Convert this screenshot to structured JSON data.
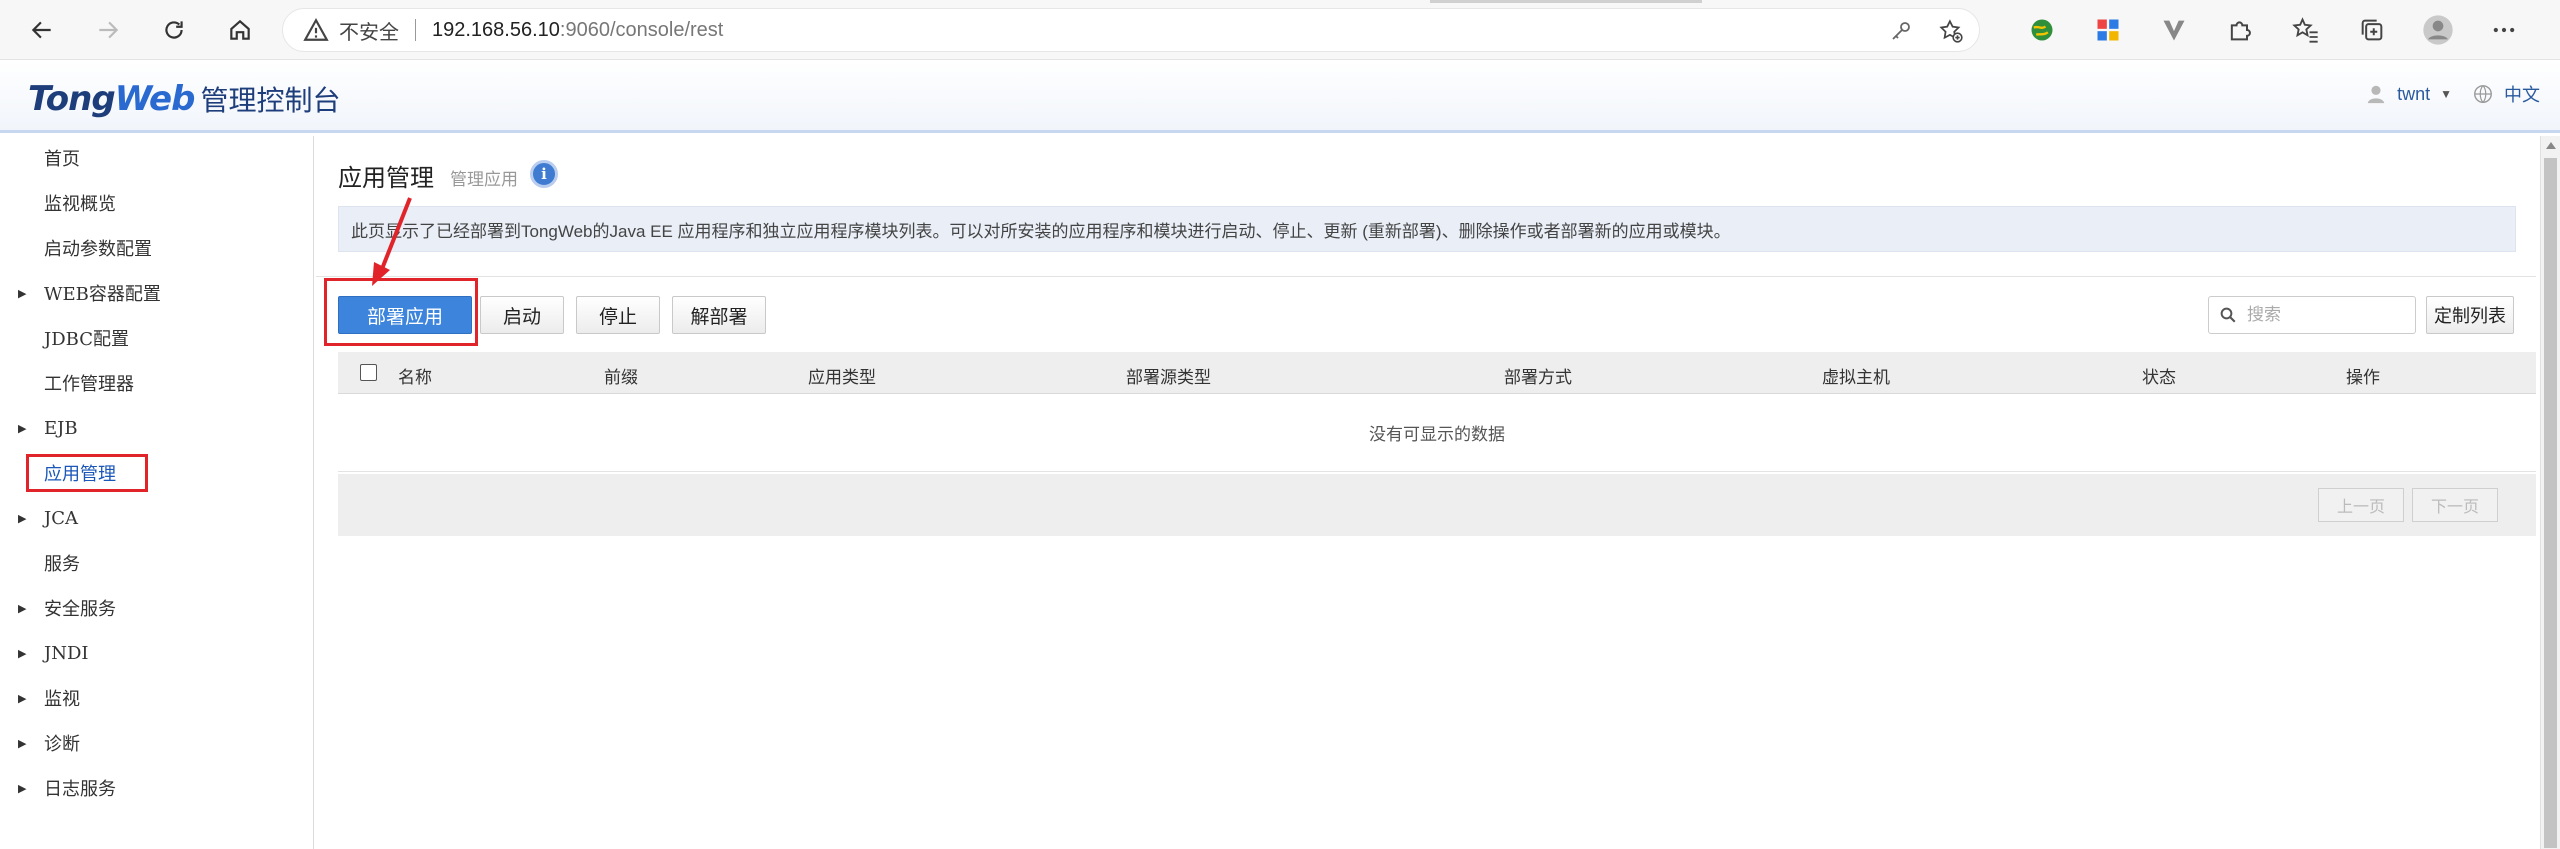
{
  "browser": {
    "insecure_label": "不安全",
    "url_host": "192.168.56.10",
    "url_path": ":9060/console/rest"
  },
  "header": {
    "brand_part1": "Tong",
    "brand_part2": "Web",
    "console_title": "管理控制台",
    "username": "twnt",
    "language": "中文"
  },
  "sidebar": {
    "items": [
      {
        "label": "首页",
        "expandable": false
      },
      {
        "label": "监视概览",
        "expandable": false
      },
      {
        "label": "启动参数配置",
        "expandable": false
      },
      {
        "label": "WEB容器配置",
        "expandable": true
      },
      {
        "label": "JDBC配置",
        "expandable": false
      },
      {
        "label": "工作管理器",
        "expandable": false
      },
      {
        "label": "EJB",
        "expandable": true
      },
      {
        "label": "应用管理",
        "expandable": false,
        "active": true
      },
      {
        "label": "JCA",
        "expandable": true
      },
      {
        "label": "服务",
        "expandable": false
      },
      {
        "label": "安全服务",
        "expandable": true
      },
      {
        "label": "JNDI",
        "expandable": true
      },
      {
        "label": "监视",
        "expandable": true
      },
      {
        "label": "诊断",
        "expandable": true
      },
      {
        "label": "日志服务",
        "expandable": true
      }
    ]
  },
  "main": {
    "title": "应用管理",
    "subtitle": "管理应用",
    "info_glyph": "i",
    "description": "此页显示了已经部署到TongWeb的Java EE 应用程序和独立应用程序模块列表。可以对所安装的应用程序和模块进行启动、停止、更新 (重新部署)、删除操作或者部署新的应用或模块。",
    "toolbar": {
      "deploy": "部署应用",
      "start": "启动",
      "stop": "停止",
      "undeploy": "解部署",
      "search_placeholder": "搜索",
      "customize": "定制列表"
    },
    "table": {
      "columns": [
        "名称",
        "前缀",
        "应用类型",
        "部署源类型",
        "部署方式",
        "虚拟主机",
        "状态",
        "操作"
      ],
      "empty_text": "没有可显示的数据"
    },
    "pager": {
      "prev": "上一页",
      "next": "下一页"
    }
  },
  "colors": {
    "primary_button": "#3c84dc",
    "highlight_box": "#e0242a",
    "annotation_arrow": "#e0242a"
  }
}
